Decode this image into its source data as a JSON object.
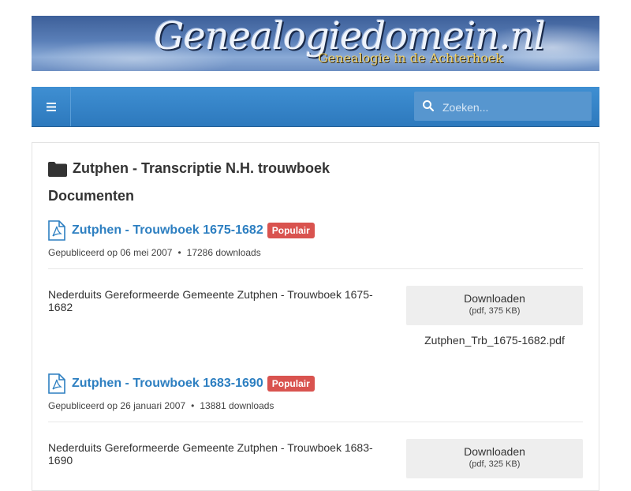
{
  "banner": {
    "title": "Genealogiedomein.nl",
    "subtitle": "Genealogie in de Achterhoek"
  },
  "nav": {
    "menu_icon": "bars-icon",
    "search_placeholder": "Zoeken..."
  },
  "category": {
    "title": "Zutphen - Transcriptie N.H. trouwboek",
    "icon": "folder-icon"
  },
  "section_title": "Documenten",
  "documents": [
    {
      "title": "Zutphen - Trouwboek 1675-1682",
      "badge": "Populair",
      "published": "Gepubliceerd op 06 mei 2007",
      "downloads": "17286 downloads",
      "description": "Nederduits Gereformeerde Gemeente Zutphen - Trouwboek 1675-1682",
      "download_label": "Downloaden",
      "file_info": "(pdf, 375 KB)",
      "filename": "Zutphen_Trb_1675-1682.pdf"
    },
    {
      "title": "Zutphen - Trouwboek 1683-1690",
      "badge": "Populair",
      "published": "Gepubliceerd op 26 januari 2007",
      "downloads": "13881 downloads",
      "description": "Nederduits Gereformeerde Gemeente Zutphen - Trouwboek 1683-1690",
      "download_label": "Downloaden",
      "file_info": "(pdf, 325 KB)"
    }
  ],
  "colors": {
    "nav_blue": "#2d79bd",
    "link_blue": "#2d7fc1",
    "badge_red": "#d9534f",
    "button_gray": "#eeeeee"
  }
}
